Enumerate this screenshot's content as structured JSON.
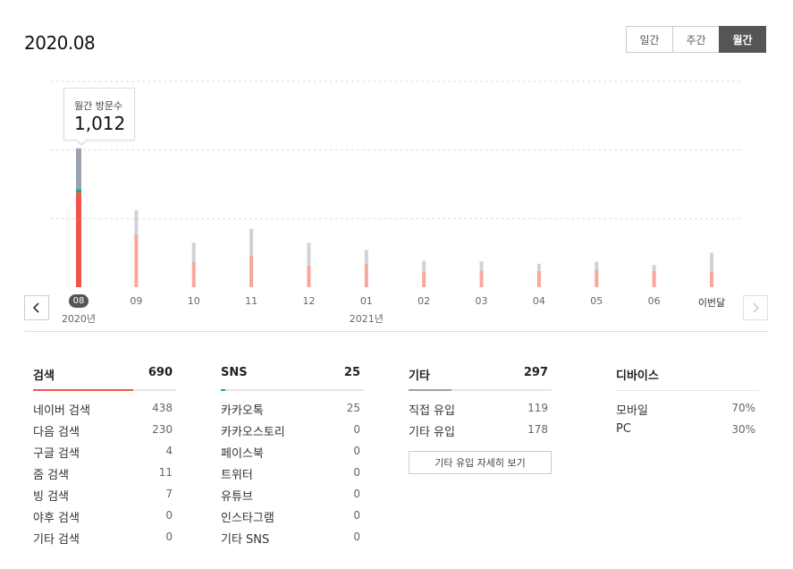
{
  "page": {
    "title": "2020.08"
  },
  "period_tabs": [
    {
      "label": "일간",
      "active": false
    },
    {
      "label": "주간",
      "active": false
    },
    {
      "label": "월간",
      "active": true
    }
  ],
  "tooltip": {
    "label": "월간 방문수",
    "value": "1,012"
  },
  "chart_data": {
    "type": "bar",
    "stacked": true,
    "categories": [
      "08",
      "09",
      "10",
      "11",
      "12",
      "01",
      "02",
      "03",
      "04",
      "05",
      "06",
      "이번달"
    ],
    "year_labels": [
      {
        "at": "08",
        "text": "2020년"
      },
      {
        "at": "01",
        "text": "2021년"
      }
    ],
    "selected": "08",
    "series": [
      {
        "color": "#f2554a",
        "faded_color": "#f8a79c",
        "values": [
          690,
          386,
          185,
          231,
          158,
          168,
          118,
          118,
          118,
          128,
          118,
          112
        ]
      },
      {
        "color": "#1aaa96",
        "faded_color": "#b4e0da",
        "values": [
          25,
          8,
          7,
          7,
          7,
          6,
          5,
          5,
          5,
          5,
          5,
          5
        ]
      },
      {
        "color": "#9aa2ad",
        "faded_color": "#cfd2d6",
        "values": [
          297,
          168,
          132,
          188,
          158,
          97,
          70,
          65,
          48,
          52,
          38,
          134
        ]
      }
    ],
    "ylim": [
      0,
      1500
    ],
    "grid": true
  },
  "nav": {
    "prev_icon": "chevron-left-icon",
    "next_icon": "chevron-right-icon"
  },
  "stats": {
    "search": {
      "label": "검색",
      "value": "690",
      "color": "#f2554a",
      "fraction": 0.7,
      "rows": [
        {
          "label": "네이버 검색",
          "value": "438"
        },
        {
          "label": "다음 검색",
          "value": "230"
        },
        {
          "label": "구글 검색",
          "value": "4"
        },
        {
          "label": "줌 검색",
          "value": "11"
        },
        {
          "label": "빙 검색",
          "value": "7"
        },
        {
          "label": "야후 검색",
          "value": "0"
        },
        {
          "label": "기타 검색",
          "value": "0"
        }
      ]
    },
    "sns": {
      "label": "SNS",
      "value": "25",
      "color": "#1aaa96",
      "fraction": 0.03,
      "rows": [
        {
          "label": "카카오톡",
          "value": "25"
        },
        {
          "label": "카카오스토리",
          "value": "0"
        },
        {
          "label": "페이스북",
          "value": "0"
        },
        {
          "label": "트위터",
          "value": "0"
        },
        {
          "label": "유튜브",
          "value": "0"
        },
        {
          "label": "인스타그램",
          "value": "0"
        },
        {
          "label": "기타 SNS",
          "value": "0"
        }
      ]
    },
    "other": {
      "label": "기타",
      "value": "297",
      "color": "#9aa2ad",
      "fraction": 0.3,
      "rows": [
        {
          "label": "직접 유입",
          "value": "119"
        },
        {
          "label": "기타 유입",
          "value": "178"
        }
      ],
      "detail_button": "기타 유입 자세히 보기"
    },
    "device": {
      "label": "디바이스",
      "rows": [
        {
          "label": "모바일",
          "value": "70%"
        },
        {
          "label": "PC",
          "value": "30%"
        }
      ]
    }
  }
}
